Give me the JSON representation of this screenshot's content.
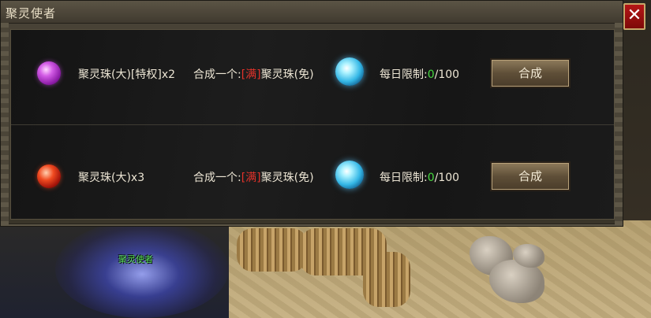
{
  "window": {
    "title": "聚灵使者",
    "close_symbol": "✕"
  },
  "npc": {
    "name": "聚灵使者"
  },
  "recipes": [
    {
      "gem_icon": "purple-orb-icon",
      "material": "聚灵珠(大)[特权]x2",
      "result_prefix": "合成一个:",
      "result_tag": "[满]",
      "result_name": "聚灵珠(免)",
      "result_icon": "blue-spirit-orb-icon",
      "limit_label": "每日限制:",
      "limit_used": "0",
      "limit_max": "/100",
      "button": "合成"
    },
    {
      "gem_icon": "red-orb-icon",
      "material": "聚灵珠(大)x3",
      "result_prefix": "合成一个:",
      "result_tag": "[满]",
      "result_name": "聚灵珠(免)",
      "result_icon": "blue-spirit-orb-icon",
      "limit_label": "每日限制:",
      "limit_used": "0",
      "limit_max": "/100",
      "button": "合成"
    }
  ],
  "colors": {
    "tag": "#e3322a",
    "count": "#46d840",
    "npc_name": "#59e05a"
  }
}
